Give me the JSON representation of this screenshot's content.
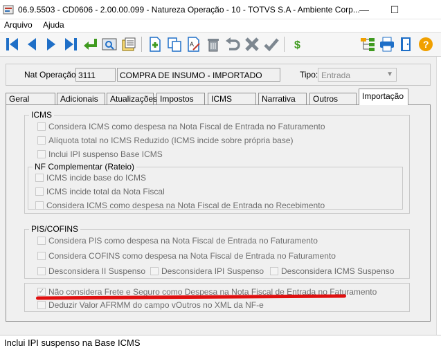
{
  "window": {
    "title": "06.9.5503 - CD0606 - 2.00.00.099 - Natureza Operação - 10 - TOTVS S.A - Ambiente Corp...",
    "minimize": "—",
    "maximize": "☐"
  },
  "menu": {
    "items": [
      "Arquivo",
      "Ajuda"
    ]
  },
  "toolbar": {
    "icons": [
      "first-record-icon",
      "previous-record-icon",
      "next-record-icon",
      "last-record-icon",
      "return-icon",
      "zoom-icon",
      "report-icon",
      "new-record-icon",
      "copy-icon",
      "edit-icon",
      "delete-icon",
      "undo-icon",
      "cancel-icon",
      "confirm-icon",
      "currency-icon",
      "structure-icon",
      "print-icon",
      "exit-icon",
      "help-icon"
    ],
    "colors": {
      "blue": "#1f6fc7",
      "green": "#3f9a1f",
      "gray": "#7d8790",
      "orange": "#f0a000"
    }
  },
  "header": {
    "nat_operacao_label": "Nat Operação:",
    "nat_operacao_code": "3111",
    "nat_operacao_desc": "COMPRA DE INSUMO - IMPORTADO",
    "tipo_label": "Tipo:",
    "tipo_value": "Entrada"
  },
  "tabs": [
    {
      "label": "Geral"
    },
    {
      "label": "Adicionais"
    },
    {
      "label": "Atualizações"
    },
    {
      "label": "Impostos"
    },
    {
      "label": "ICMS"
    },
    {
      "label": "Narrativa"
    },
    {
      "label": "Outros"
    },
    {
      "label": "Importação"
    }
  ],
  "active_tab": "Importação",
  "icms": {
    "title": "ICMS",
    "items": [
      {
        "label": "Considera ICMS como despesa na Nota Fiscal de Entrada no Faturamento",
        "checked": false
      },
      {
        "label": "Alíquota total no ICMS Reduzido (ICMS incide sobre própria base)",
        "checked": false
      },
      {
        "label": "Inclui IPI suspenso Base ICMS",
        "checked": false
      }
    ],
    "nf_complementar": {
      "title": "NF Complementar (Rateio)",
      "items": [
        {
          "label": "ICMS incide base do ICMS",
          "checked": false
        },
        {
          "label": "ICMS incide total da Nota Fiscal",
          "checked": false
        },
        {
          "label": "Considera ICMS como despesa na Nota Fiscal de Entrada no Recebimento",
          "checked": false
        }
      ]
    }
  },
  "pis_cofins": {
    "title": "PIS/COFINS",
    "items": [
      {
        "label": "Considera PIS como despesa na Nota Fiscal de Entrada no Faturamento",
        "checked": false
      },
      {
        "label": "Considera COFINS como despesa na Nota Fiscal de Entrada no Faturamento",
        "checked": false
      },
      {
        "label": "Desconsidera II Suspenso",
        "checked": false
      },
      {
        "label": "Desconsidera IPI Suspenso",
        "checked": false
      },
      {
        "label": "Desconsidera ICMS Suspenso",
        "checked": false
      }
    ]
  },
  "frete": {
    "items": [
      {
        "label": "Não considera Frete e Seguro como Despesa na Nota Fiscal de Entrada no Faturamento",
        "checked": true
      },
      {
        "label": "Deduzir Valor AFRMM do campo vOutros no XML da NF-e",
        "checked": false
      }
    ]
  },
  "status": {
    "text": "Inclui IPI suspenso na Base ICMS"
  }
}
